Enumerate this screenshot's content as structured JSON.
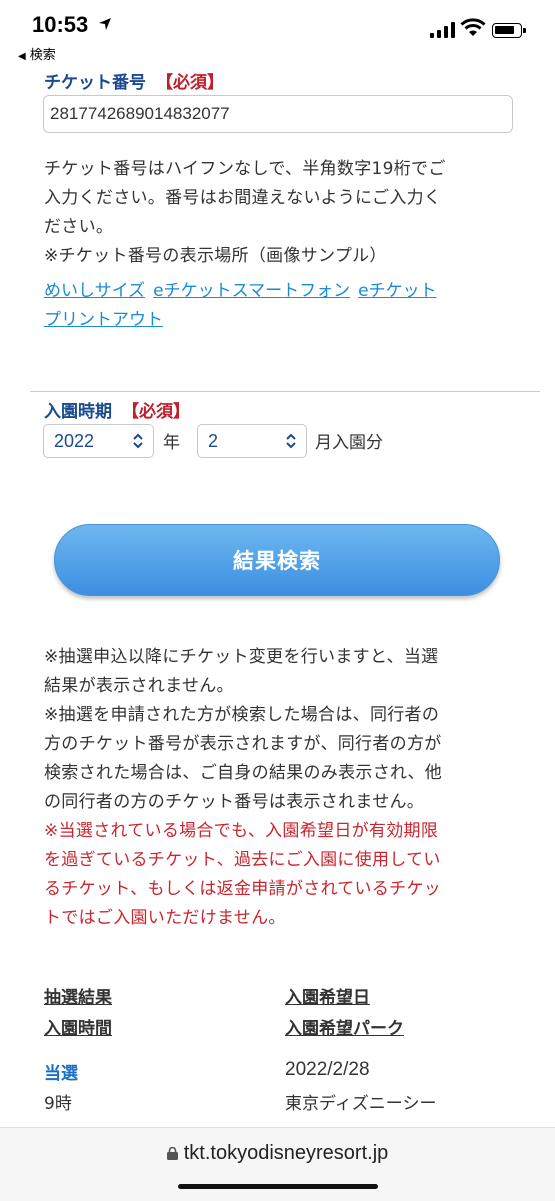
{
  "status_bar": {
    "time": "10:53",
    "back_label": "検索"
  },
  "ticket": {
    "label": "チケット番号",
    "required": "【必須】",
    "value": "2817742689014832077",
    "description_lines": [
      "チケット番号はハイフンなしで、半角数字19桁でご",
      "入力ください。番号はお間違えないようにご入力く",
      "ださい。",
      "※チケット番号の表示場所（画像サンプル）"
    ],
    "links": [
      "めいしサイズ",
      "eチケットスマートフォン",
      "eチケット",
      "プリントアウト"
    ]
  },
  "entry": {
    "label": "入園時期",
    "required": "【必須】",
    "year": "2022",
    "year_unit": "年",
    "month": "2",
    "month_unit": "月入園分"
  },
  "search_button": "結果検索",
  "notes": [
    "※抽選申込以降にチケット変更を行いますと、当選",
    "結果が表示されません。",
    "※抽選を申請された方が検索した場合は、同行者の",
    "方のチケット番号が表示されますが、同行者の方が",
    "検索された場合は、ご自身の結果のみ表示され、他",
    "の同行者の方のチケット番号は表示されません。"
  ],
  "red_notes": [
    "※当選されている場合でも、入園希望日が有効期限",
    "を過ぎているチケット、過去にご入園に使用してい",
    "るチケット、もしくは返金申請がされているチケッ",
    "トではご入園いただけません。"
  ],
  "results": {
    "headers": [
      "抽選結果",
      "入園希望日",
      "入園時間",
      "入園希望パーク"
    ],
    "result": "当選",
    "date": "2022/2/28",
    "time": "9時",
    "park": "東京ディズニーシー"
  },
  "url": "tkt.tokyodisneyresort.jp",
  "colors": {
    "label_blue": "#1b4b8e",
    "required_red": "#c0202c",
    "link_blue": "#1a8bd6",
    "button_blue": "#3c8fe1"
  }
}
